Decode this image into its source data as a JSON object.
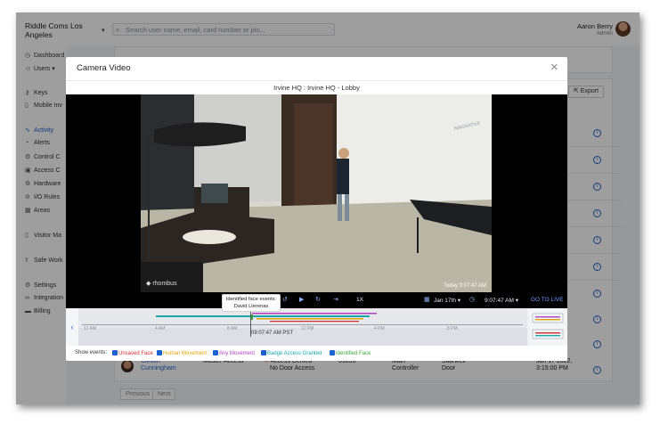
{
  "app": {
    "org_name": "Riddle Coms Los Angeles",
    "search_placeholder": "Search user name, email, card number or pin...",
    "user_name": "Aaron Berry",
    "user_role": "Admin"
  },
  "sidebar": {
    "items": [
      {
        "label": "Dashboard",
        "icon": "dashboard-icon"
      },
      {
        "label": "Users",
        "icon": "users-icon"
      },
      {
        "label": "Keys",
        "icon": "key-icon"
      },
      {
        "label": "Mobile Inv",
        "icon": "mobile-icon"
      },
      {
        "label": "Activity",
        "icon": "activity-icon"
      },
      {
        "label": "Alerts",
        "icon": "bell-icon"
      },
      {
        "label": "Control C",
        "icon": "control-icon"
      },
      {
        "label": "Access C",
        "icon": "lock-icon"
      },
      {
        "label": "Hardware",
        "icon": "hardware-icon"
      },
      {
        "label": "I/O Rules",
        "icon": "rules-icon"
      },
      {
        "label": "Areas",
        "icon": "areas-icon"
      },
      {
        "label": "Visitor Ma",
        "icon": "visitor-icon"
      },
      {
        "label": "Safe Work",
        "icon": "safe-icon"
      },
      {
        "label": "Settings",
        "icon": "gear-icon"
      },
      {
        "label": "Integration",
        "icon": "integration-icon"
      },
      {
        "label": "Billing",
        "icon": "billing-icon"
      }
    ]
  },
  "background": {
    "export_label": "Export",
    "row": {
      "name_first": "Clinton",
      "name_last": "Cunningham",
      "access": "Master Access",
      "result_line1": "Access Denied -",
      "result_line2": "No Door Access",
      "card": "51898",
      "controller_line1": "Main",
      "controller_line2": "Controller",
      "door_line1": "Stairwell",
      "door_line2": "Door",
      "date_line1": "Jan 17 2022,",
      "date_line2": "3:15:00 PM"
    },
    "pager_prev": "Previous",
    "pager_next": "Next"
  },
  "modal": {
    "title": "Camera Video",
    "camera_name": "Irvine HQ : Irvine HQ - Lobby",
    "video_timestamp": "Today 9:07:47 AM",
    "logo_text": "rhombus",
    "controls": {
      "rate": "1X",
      "date": "Jan 17th",
      "time": "9:07:47 AM",
      "go_live": "GO TO LIVE"
    },
    "tooltip_title": "Identified face events:",
    "tooltip_name": "David Llerenas",
    "timeline_labels": [
      "12 AM",
      "4 AM",
      "8 AM",
      "12 PM",
      "4 PM",
      "8 PM"
    ],
    "cursor_label": "09:07:47 AM PST",
    "legend_label": "Show events:",
    "legend": [
      {
        "label": "Unsaved Face",
        "color": "#d12c2c"
      },
      {
        "label": "Human Movement",
        "color": "#e0a400"
      },
      {
        "label": "Any Movement",
        "color": "#b03fc6"
      },
      {
        "label": "Badge Access Granted",
        "color": "#1aa7a7"
      },
      {
        "label": "Identified Face",
        "color": "#3aa63a"
      }
    ]
  }
}
